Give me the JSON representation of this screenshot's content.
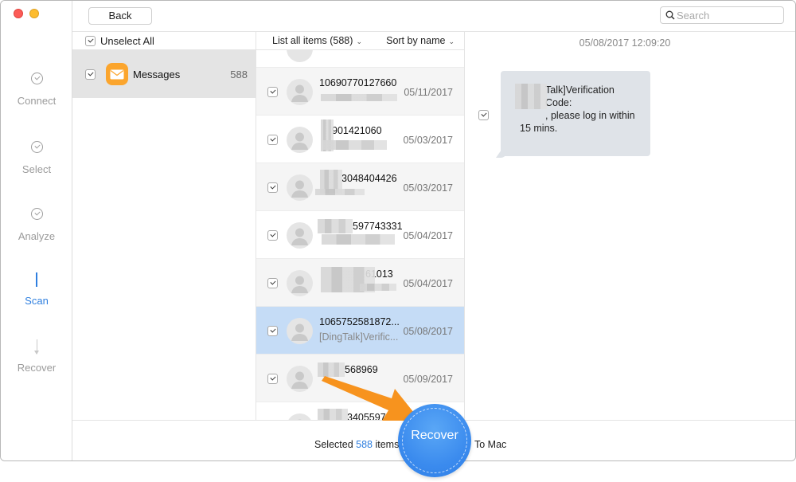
{
  "window": {
    "traffic_lights": [
      "close",
      "minimize"
    ]
  },
  "steps": [
    {
      "label": "Connect",
      "state": "done",
      "icon": "check-circle-icon"
    },
    {
      "label": "Select",
      "state": "done",
      "icon": "check-circle-icon"
    },
    {
      "label": "Analyze",
      "state": "done",
      "icon": "check-circle-icon"
    },
    {
      "label": "Scan",
      "state": "active",
      "icon": "progress-line-icon"
    },
    {
      "label": "Recover",
      "state": "pending",
      "icon": "arrow-down-icon"
    }
  ],
  "toolbar": {
    "back_label": "Back",
    "search_placeholder": "Search"
  },
  "categories": {
    "unselect_all_label": "Unselect All",
    "items": [
      {
        "name": "Messages",
        "count": "588",
        "checked": true,
        "icon": "envelope-icon"
      }
    ]
  },
  "list": {
    "filter_label": "List all items (588)",
    "sort_label": "Sort by name",
    "rows": [
      {
        "number": "10690770127660",
        "preview": "",
        "date": "05/11/2017",
        "checked": true,
        "selected": false,
        "blurred_number": false,
        "blurred_preview": true
      },
      {
        "number": "901421060",
        "preview": "",
        "date": "05/03/2017",
        "checked": true,
        "selected": false,
        "blurred_number": true,
        "blurred_preview": true
      },
      {
        "number": "3048404426",
        "preview": "",
        "date": "05/03/2017",
        "checked": true,
        "selected": false,
        "blurred_number": true,
        "blurred_preview": true
      },
      {
        "number": "597743331",
        "preview": "",
        "date": "05/04/2017",
        "checked": true,
        "selected": false,
        "blurred_number": true,
        "blurred_preview": true
      },
      {
        "number": "61013",
        "preview": "",
        "date": "05/04/2017",
        "checked": true,
        "selected": false,
        "blurred_number": true,
        "blurred_preview": true
      },
      {
        "number": "1065752581872...",
        "preview": "[DingTalk]Verific...",
        "date": "05/08/2017",
        "checked": true,
        "selected": true,
        "blurred_number": false,
        "blurred_preview": false
      },
      {
        "number": "568969",
        "preview": "",
        "date": "05/09/2017",
        "checked": true,
        "selected": false,
        "blurred_number": true,
        "blurred_preview": false
      },
      {
        "number": "3405597...",
        "preview": "",
        "date": "",
        "checked": true,
        "selected": false,
        "blurred_number": true,
        "blurred_preview": false
      }
    ]
  },
  "detail": {
    "timestamp": "05/08/2017 12:09:20",
    "message_line1": "Talk]Verification Code:",
    "message_line2": ", please log in within",
    "message_line3": "15 mins.",
    "checked": true
  },
  "footer": {
    "selected_prefix": "Selected",
    "selected_count": "588",
    "selected_suffix": "items",
    "recover_label": "Recover",
    "destination": "To Mac"
  },
  "colors": {
    "accent": "#2f7fdf",
    "selected_row": "#c5dcf6",
    "annotation_arrow": "#f7931e",
    "messages_icon": "#fba52d"
  }
}
